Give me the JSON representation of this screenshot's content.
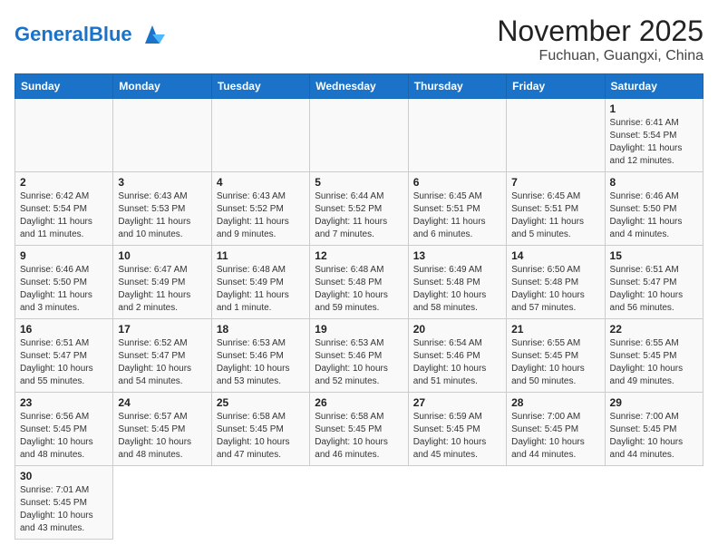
{
  "header": {
    "logo_general": "General",
    "logo_blue": "Blue",
    "month_year": "November 2025",
    "location": "Fuchuan, Guangxi, China"
  },
  "weekdays": [
    "Sunday",
    "Monday",
    "Tuesday",
    "Wednesday",
    "Thursday",
    "Friday",
    "Saturday"
  ],
  "days": [
    {
      "num": "",
      "sunrise": "",
      "sunset": "",
      "daylight": "",
      "empty": true
    },
    {
      "num": "",
      "sunrise": "",
      "sunset": "",
      "daylight": "",
      "empty": true
    },
    {
      "num": "",
      "sunrise": "",
      "sunset": "",
      "daylight": "",
      "empty": true
    },
    {
      "num": "",
      "sunrise": "",
      "sunset": "",
      "daylight": "",
      "empty": true
    },
    {
      "num": "",
      "sunrise": "",
      "sunset": "",
      "daylight": "",
      "empty": true
    },
    {
      "num": "",
      "sunrise": "",
      "sunset": "",
      "daylight": "",
      "empty": true
    },
    {
      "num": "1",
      "sunrise": "Sunrise: 6:41 AM",
      "sunset": "Sunset: 5:54 PM",
      "daylight": "Daylight: 11 hours and 12 minutes.",
      "empty": false
    },
    {
      "num": "2",
      "sunrise": "Sunrise: 6:42 AM",
      "sunset": "Sunset: 5:54 PM",
      "daylight": "Daylight: 11 hours and 11 minutes.",
      "empty": false
    },
    {
      "num": "3",
      "sunrise": "Sunrise: 6:43 AM",
      "sunset": "Sunset: 5:53 PM",
      "daylight": "Daylight: 11 hours and 10 minutes.",
      "empty": false
    },
    {
      "num": "4",
      "sunrise": "Sunrise: 6:43 AM",
      "sunset": "Sunset: 5:52 PM",
      "daylight": "Daylight: 11 hours and 9 minutes.",
      "empty": false
    },
    {
      "num": "5",
      "sunrise": "Sunrise: 6:44 AM",
      "sunset": "Sunset: 5:52 PM",
      "daylight": "Daylight: 11 hours and 7 minutes.",
      "empty": false
    },
    {
      "num": "6",
      "sunrise": "Sunrise: 6:45 AM",
      "sunset": "Sunset: 5:51 PM",
      "daylight": "Daylight: 11 hours and 6 minutes.",
      "empty": false
    },
    {
      "num": "7",
      "sunrise": "Sunrise: 6:45 AM",
      "sunset": "Sunset: 5:51 PM",
      "daylight": "Daylight: 11 hours and 5 minutes.",
      "empty": false
    },
    {
      "num": "8",
      "sunrise": "Sunrise: 6:46 AM",
      "sunset": "Sunset: 5:50 PM",
      "daylight": "Daylight: 11 hours and 4 minutes.",
      "empty": false
    },
    {
      "num": "9",
      "sunrise": "Sunrise: 6:46 AM",
      "sunset": "Sunset: 5:50 PM",
      "daylight": "Daylight: 11 hours and 3 minutes.",
      "empty": false
    },
    {
      "num": "10",
      "sunrise": "Sunrise: 6:47 AM",
      "sunset": "Sunset: 5:49 PM",
      "daylight": "Daylight: 11 hours and 2 minutes.",
      "empty": false
    },
    {
      "num": "11",
      "sunrise": "Sunrise: 6:48 AM",
      "sunset": "Sunset: 5:49 PM",
      "daylight": "Daylight: 11 hours and 1 minute.",
      "empty": false
    },
    {
      "num": "12",
      "sunrise": "Sunrise: 6:48 AM",
      "sunset": "Sunset: 5:48 PM",
      "daylight": "Daylight: 10 hours and 59 minutes.",
      "empty": false
    },
    {
      "num": "13",
      "sunrise": "Sunrise: 6:49 AM",
      "sunset": "Sunset: 5:48 PM",
      "daylight": "Daylight: 10 hours and 58 minutes.",
      "empty": false
    },
    {
      "num": "14",
      "sunrise": "Sunrise: 6:50 AM",
      "sunset": "Sunset: 5:48 PM",
      "daylight": "Daylight: 10 hours and 57 minutes.",
      "empty": false
    },
    {
      "num": "15",
      "sunrise": "Sunrise: 6:51 AM",
      "sunset": "Sunset: 5:47 PM",
      "daylight": "Daylight: 10 hours and 56 minutes.",
      "empty": false
    },
    {
      "num": "16",
      "sunrise": "Sunrise: 6:51 AM",
      "sunset": "Sunset: 5:47 PM",
      "daylight": "Daylight: 10 hours and 55 minutes.",
      "empty": false
    },
    {
      "num": "17",
      "sunrise": "Sunrise: 6:52 AM",
      "sunset": "Sunset: 5:47 PM",
      "daylight": "Daylight: 10 hours and 54 minutes.",
      "empty": false
    },
    {
      "num": "18",
      "sunrise": "Sunrise: 6:53 AM",
      "sunset": "Sunset: 5:46 PM",
      "daylight": "Daylight: 10 hours and 53 minutes.",
      "empty": false
    },
    {
      "num": "19",
      "sunrise": "Sunrise: 6:53 AM",
      "sunset": "Sunset: 5:46 PM",
      "daylight": "Daylight: 10 hours and 52 minutes.",
      "empty": false
    },
    {
      "num": "20",
      "sunrise": "Sunrise: 6:54 AM",
      "sunset": "Sunset: 5:46 PM",
      "daylight": "Daylight: 10 hours and 51 minutes.",
      "empty": false
    },
    {
      "num": "21",
      "sunrise": "Sunrise: 6:55 AM",
      "sunset": "Sunset: 5:45 PM",
      "daylight": "Daylight: 10 hours and 50 minutes.",
      "empty": false
    },
    {
      "num": "22",
      "sunrise": "Sunrise: 6:55 AM",
      "sunset": "Sunset: 5:45 PM",
      "daylight": "Daylight: 10 hours and 49 minutes.",
      "empty": false
    },
    {
      "num": "23",
      "sunrise": "Sunrise: 6:56 AM",
      "sunset": "Sunset: 5:45 PM",
      "daylight": "Daylight: 10 hours and 48 minutes.",
      "empty": false
    },
    {
      "num": "24",
      "sunrise": "Sunrise: 6:57 AM",
      "sunset": "Sunset: 5:45 PM",
      "daylight": "Daylight: 10 hours and 48 minutes.",
      "empty": false
    },
    {
      "num": "25",
      "sunrise": "Sunrise: 6:58 AM",
      "sunset": "Sunset: 5:45 PM",
      "daylight": "Daylight: 10 hours and 47 minutes.",
      "empty": false
    },
    {
      "num": "26",
      "sunrise": "Sunrise: 6:58 AM",
      "sunset": "Sunset: 5:45 PM",
      "daylight": "Daylight: 10 hours and 46 minutes.",
      "empty": false
    },
    {
      "num": "27",
      "sunrise": "Sunrise: 6:59 AM",
      "sunset": "Sunset: 5:45 PM",
      "daylight": "Daylight: 10 hours and 45 minutes.",
      "empty": false
    },
    {
      "num": "28",
      "sunrise": "Sunrise: 7:00 AM",
      "sunset": "Sunset: 5:45 PM",
      "daylight": "Daylight: 10 hours and 44 minutes.",
      "empty": false
    },
    {
      "num": "29",
      "sunrise": "Sunrise: 7:00 AM",
      "sunset": "Sunset: 5:45 PM",
      "daylight": "Daylight: 10 hours and 44 minutes.",
      "empty": false
    },
    {
      "num": "30",
      "sunrise": "Sunrise: 7:01 AM",
      "sunset": "Sunset: 5:45 PM",
      "daylight": "Daylight: 10 hours and 43 minutes.",
      "empty": false
    }
  ]
}
